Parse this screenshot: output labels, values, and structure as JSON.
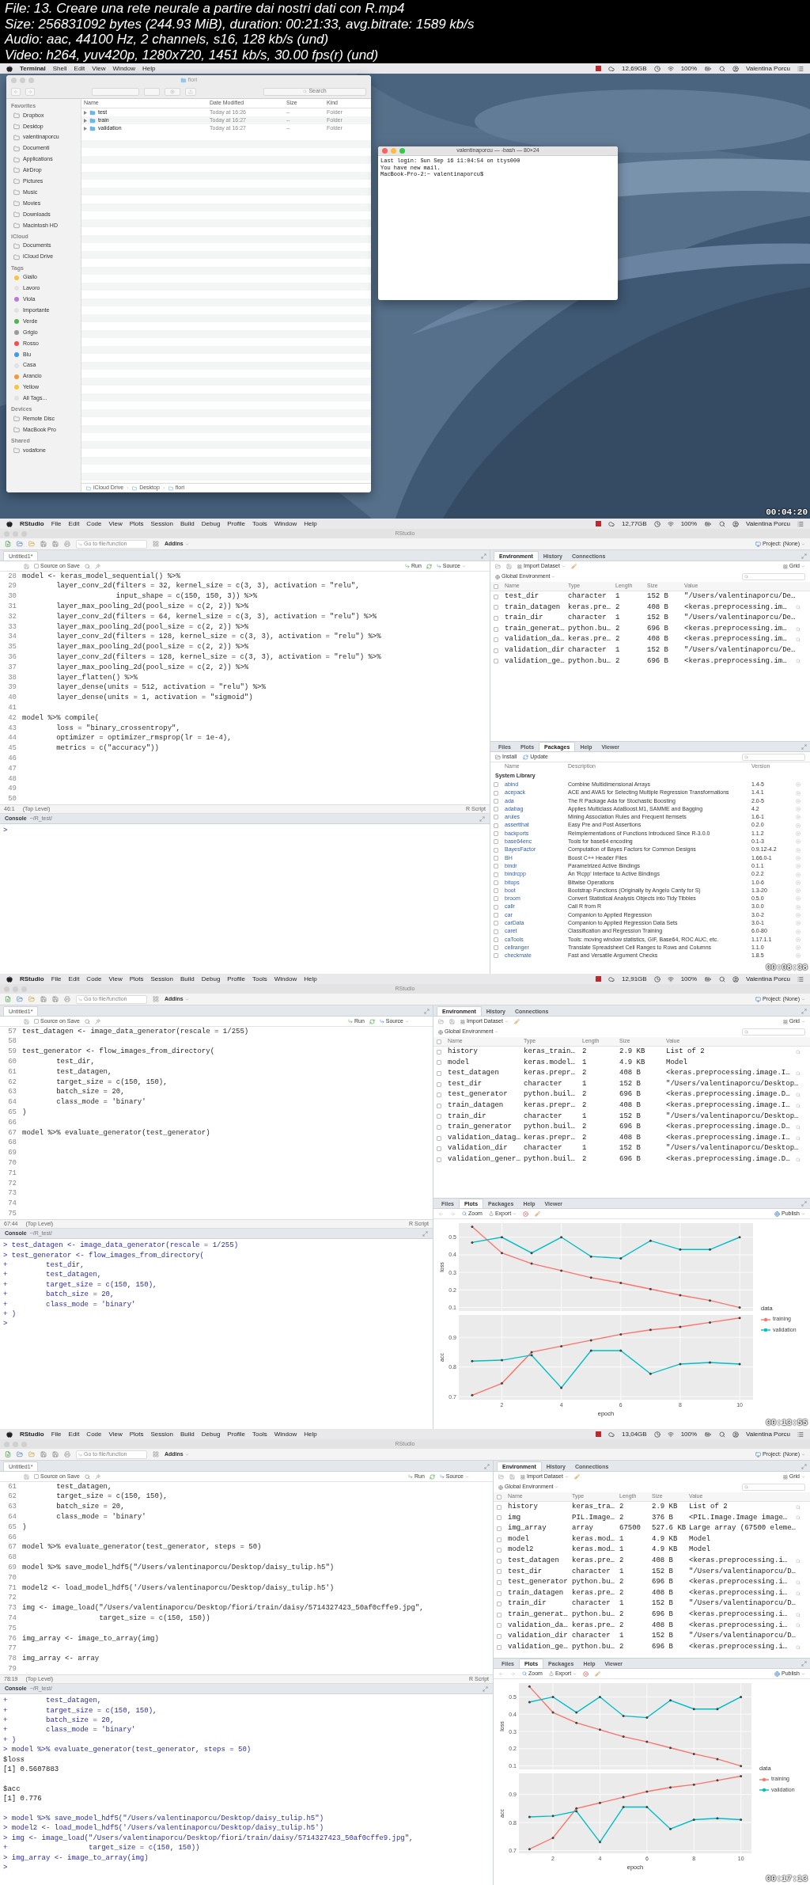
{
  "file_info": [
    "File: 13. Creare una rete neurale a partire dai nostri dati con R.mp4",
    "Size: 256831092 bytes (244.93 MiB), duration: 00:21:33, avg.bitrate: 1589 kb/s",
    "Audio: aac, 44100 Hz, 2 channels, s16, 128 kb/s (und)",
    "Video: h264, yuv420p, 1280x720, 1451 kb/s, 30.00 fps(r) (und)"
  ],
  "frames": [
    {
      "kind": "desktop",
      "menubar": {
        "app": "Terminal",
        "menus": [
          "Shell",
          "Edit",
          "View",
          "Window",
          "Help"
        ],
        "storage": "12,69GB",
        "battery": "100%",
        "user": "Valentina Porcu"
      },
      "finder": {
        "title": "fiori",
        "search": {
          "placeholder": "Search"
        },
        "sections": [
          {
            "title": "Favorites",
            "kind": "places",
            "items": [
              "Dropbox",
              "Desktop",
              "valentinaporcu",
              "Documenti",
              "Applications",
              "AirDrop",
              "Pictures",
              "Music",
              "Movies",
              "Downloads",
              "Macintosh HD"
            ]
          },
          {
            "title": "iCloud",
            "kind": "places",
            "items": [
              "Documents",
              "iCloud Drive"
            ]
          },
          {
            "title": "Tags",
            "kind": "tags",
            "items": [
              {
                "label": "Giallo",
                "color": "#f5c542"
              },
              {
                "label": "Lavoro",
                "color": "#e2e2e2"
              },
              {
                "label": "Viola",
                "color": "#b67ae0"
              },
              {
                "label": "Importante",
                "color": "#e2e2e2"
              },
              {
                "label": "Verde",
                "color": "#4cb84c"
              },
              {
                "label": "Grigio",
                "color": "#9a9a9a"
              },
              {
                "label": "Rosso",
                "color": "#f0504f"
              },
              {
                "label": "Blu",
                "color": "#3d9cf0"
              },
              {
                "label": "Casa",
                "color": "#e2e2e2"
              },
              {
                "label": "Arancio",
                "color": "#f59a32"
              },
              {
                "label": "Yellow",
                "color": "#f5c542"
              },
              {
                "label": "All Tags...",
                "color": "#e2e2e2"
              }
            ]
          },
          {
            "title": "Devices",
            "kind": "places",
            "items": [
              "Remote Disc",
              "MacBook Pro"
            ]
          },
          {
            "title": "Shared",
            "kind": "places",
            "items": [
              "vodafone"
            ]
          }
        ],
        "columns": [
          "Name",
          "Date Modified",
          "Size",
          "Kind"
        ],
        "rows": [
          {
            "name": "test",
            "date": "Today at 16:26",
            "size": "--",
            "file_kind": "Folder"
          },
          {
            "name": "train",
            "date": "Today at 16:27",
            "size": "--",
            "file_kind": "Folder"
          },
          {
            "name": "validation",
            "date": "Today at 16:27",
            "size": "--",
            "file_kind": "Folder"
          }
        ],
        "path": [
          "iCloud Drive",
          "Desktop",
          "fiori"
        ]
      },
      "terminal": {
        "title": "valentinaporcu — -bash — 80×24",
        "lines": [
          "Last login: Sun Sep 16 11:04:54 on ttys000",
          "You have new mail.",
          "MacBook-Pro-2:~ valentinaporcu$"
        ]
      },
      "timestamp": "00:04:20"
    },
    {
      "kind": "rstudio",
      "menubar": {
        "app": "RStudio",
        "menus": [
          "File",
          "Edit",
          "Code",
          "View",
          "Plots",
          "Session",
          "Build",
          "Debug",
          "Profile",
          "Tools",
          "Window",
          "Help"
        ],
        "storage": "12,77GB",
        "battery": "100%",
        "user": "Valentina Porcu"
      },
      "window_title": "RStudio",
      "goto": {
        "placeholder": "Go to file/function"
      },
      "addins": "Addins",
      "project": "Project: (None)",
      "source": {
        "tab": "Untitled1*",
        "source_on_save": {
          "label": "Source on Save",
          "checked": false
        },
        "run": "Run",
        "source_button": "Source",
        "position": "46:1",
        "scope": "(Top Level)",
        "file_type": "R Script",
        "lines": [
          {
            "n": "28",
            "text": "model <- keras_model_sequential() %>%"
          },
          {
            "n": "29",
            "text": "        layer_conv_2d(filters = 32, kernel_size = c(3, 3), activation = \"relu\","
          },
          {
            "n": "30",
            "text": "                      input_shape = c(150, 150, 3)) %>%"
          },
          {
            "n": "31",
            "text": "        layer_max_pooling_2d(pool_size = c(2, 2)) %>%"
          },
          {
            "n": "32",
            "text": "        layer_conv_2d(filters = 64, kernel_size = c(3, 3), activation = \"relu\") %>%"
          },
          {
            "n": "33",
            "text": "        layer_max_pooling_2d(pool_size = c(2, 2)) %>%"
          },
          {
            "n": "34",
            "text": "        layer_conv_2d(filters = 128, kernel_size = c(3, 3), activation = \"relu\") %>%"
          },
          {
            "n": "35",
            "text": "        layer_max_pooling_2d(pool_size = c(2, 2)) %>%"
          },
          {
            "n": "36",
            "text": "        layer_conv_2d(filters = 128, kernel_size = c(3, 3), activation = \"relu\") %>%"
          },
          {
            "n": "37",
            "text": "        layer_max_pooling_2d(pool_size = c(2, 2)) %>%"
          },
          {
            "n": "38",
            "text": "        layer_flatten() %>%"
          },
          {
            "n": "39",
            "text": "        layer_dense(units = 512, activation = \"relu\") %>%"
          },
          {
            "n": "40",
            "text": "        layer_dense(units = 1, activation = \"sigmoid\")"
          },
          {
            "n": "41"
          },
          {
            "n": "42",
            "text": "model %>% compile("
          },
          {
            "n": "43",
            "text": "        loss = \"binary_crossentropy\","
          },
          {
            "n": "44",
            "text": "        optimizer = optimizer_rmsprop(lr = 1e-4),"
          },
          {
            "n": "45",
            "text": "        metrics = c(\"accuracy\"))"
          },
          {
            "n": "46"
          },
          {
            "n": "47"
          },
          {
            "n": "48"
          },
          {
            "n": "49"
          },
          {
            "n": "50"
          }
        ]
      },
      "console": {
        "title": "Console",
        "path": "~/R_test/",
        "lines": [
          {
            "kind": "input",
            "text": ">"
          }
        ]
      },
      "environment": {
        "tabs": [
          {
            "label": "Environment",
            "selected": true
          },
          {
            "label": "History",
            "selected": false
          },
          {
            "label": "Connections",
            "selected": false
          }
        ],
        "import": "Import Dataset",
        "view": "Grid",
        "scope": "Global Environment",
        "all_checked": false,
        "columns": [
          "Name",
          "Type",
          "Length",
          "Size",
          "Value"
        ],
        "rows": [
          {
            "name": "test_dir",
            "type": "character",
            "length": "1",
            "size": "152 B",
            "value": "\"/Users/valentinaporcu/De…",
            "inspect": false,
            "checked": false
          },
          {
            "name": "train_datagen",
            "type": "keras.pre…",
            "length": "2",
            "size": "408 B",
            "value": "<keras.preprocessing.im…",
            "inspect": true,
            "checked": false
          },
          {
            "name": "train_dir",
            "type": "character",
            "length": "1",
            "size": "152 B",
            "value": "\"/Users/valentinaporcu/De…",
            "inspect": false,
            "checked": false
          },
          {
            "name": "train_generat…",
            "type": "python.bu…",
            "length": "2",
            "size": "696 B",
            "value": "<keras.preprocessing.im…",
            "inspect": true,
            "checked": false
          },
          {
            "name": "validation_da…",
            "type": "keras.pre…",
            "length": "2",
            "size": "408 B",
            "value": "<keras.preprocessing.im…",
            "inspect": true,
            "checked": false
          },
          {
            "name": "validation_dir",
            "type": "character",
            "length": "1",
            "size": "152 B",
            "value": "\"/Users/valentinaporcu/De…",
            "inspect": false,
            "checked": false
          },
          {
            "name": "validation_ge…",
            "type": "python.bu…",
            "length": "2",
            "size": "696 B",
            "value": "<keras.preprocessing.im…",
            "inspect": true,
            "checked": false
          }
        ]
      },
      "lower": {
        "kind": "packages",
        "tabs": [
          {
            "label": "Files",
            "selected": false
          },
          {
            "label": "Plots",
            "selected": false
          },
          {
            "label": "Packages",
            "selected": true
          },
          {
            "label": "Help",
            "selected": false
          },
          {
            "label": "Viewer",
            "selected": false
          }
        ],
        "install": "Install",
        "update": "Update",
        "columns": [
          "Name",
          "Description",
          "Version"
        ],
        "library": "System Library",
        "packages": [
          {
            "name": "abind",
            "description": "Combine Multidimensional Arrays",
            "version": "1.4-5",
            "checked": false
          },
          {
            "name": "acepack",
            "description": "ACE and AVAS for Selecting Multiple Regression Transformations",
            "version": "1.4.1",
            "checked": false
          },
          {
            "name": "ada",
            "description": "The R Package Ada for Stochastic Boosting",
            "version": "2.0-5",
            "checked": false
          },
          {
            "name": "adabag",
            "description": "Applies Multiclass AdaBoost.M1, SAMME and Bagging",
            "version": "4.2",
            "checked": false
          },
          {
            "name": "arules",
            "description": "Mining Association Rules and Frequent Itemsets",
            "version": "1.6-1",
            "checked": false
          },
          {
            "name": "assertthat",
            "description": "Easy Pre and Post Assertions",
            "version": "0.2.0",
            "checked": false
          },
          {
            "name": "backports",
            "description": "Reimplementations of Functions Introduced Since R-3.0.0",
            "version": "1.1.2",
            "checked": false
          },
          {
            "name": "base64enc",
            "description": "Tools for base64 encoding",
            "version": "0.1-3",
            "checked": false
          },
          {
            "name": "BayesFactor",
            "description": "Computation of Bayes Factors for Common Designs",
            "version": "0.9.12-4.2",
            "checked": false
          },
          {
            "name": "BH",
            "description": "Boost C++ Header Files",
            "version": "1.66.0-1",
            "checked": false
          },
          {
            "name": "bindr",
            "description": "Parametrized Active Bindings",
            "version": "0.1.1",
            "checked": false
          },
          {
            "name": "bindrcpp",
            "description": "An 'Rcpp' Interface to Active Bindings",
            "version": "0.2.2",
            "checked": false
          },
          {
            "name": "bitops",
            "description": "Bitwise Operations",
            "version": "1.0-6",
            "checked": false
          },
          {
            "name": "boot",
            "description": "Bootstrap Functions (Originally by Angelo Canty for S)",
            "version": "1.3-20",
            "checked": false
          },
          {
            "name": "broom",
            "description": "Convert Statistical Analysis Objects into Tidy Tibbles",
            "version": "0.5.0",
            "checked": false
          },
          {
            "name": "callr",
            "description": "Call R from R",
            "version": "3.0.0",
            "checked": false
          },
          {
            "name": "car",
            "description": "Companion to Applied Regression",
            "version": "3.0-2",
            "checked": false
          },
          {
            "name": "carData",
            "description": "Companion to Applied Regression Data Sets",
            "version": "3.0-1",
            "checked": false
          },
          {
            "name": "caret",
            "description": "Classification and Regression Training",
            "version": "6.0-80",
            "checked": false
          },
          {
            "name": "caTools",
            "description": "Tools: moving window statistics, GIF, Base64, ROC AUC, etc.",
            "version": "1.17.1.1",
            "checked": false
          },
          {
            "name": "cellranger",
            "description": "Translate Spreadsheet Cell Ranges to Rows and Columns",
            "version": "1.1.0",
            "checked": false
          },
          {
            "name": "checkmate",
            "description": "Fast and Versatile Argument Checks",
            "version": "1.8.5",
            "checked": false
          }
        ]
      },
      "timestamp": "00:08:38"
    },
    {
      "kind": "rstudio",
      "menubar": {
        "app": "RStudio",
        "menus": [
          "File",
          "Edit",
          "Code",
          "View",
          "Plots",
          "Session",
          "Build",
          "Debug",
          "Profile",
          "Tools",
          "Window",
          "Help"
        ],
        "storage": "12,91GB",
        "battery": "100%",
        "user": "Valentina Porcu"
      },
      "window_title": "RStudio",
      "goto": {
        "placeholder": "Go to file/function"
      },
      "addins": "Addins",
      "project": "Project: (None)",
      "source": {
        "tab": "Untitled1*",
        "source_on_save": {
          "label": "Source on Save",
          "checked": false
        },
        "run": "Run",
        "source_button": "Source",
        "position": "67:44",
        "scope": "(Top Level)",
        "file_type": "R Script",
        "lines": [
          {
            "n": "57",
            "text": "test_datagen <- image_data_generator(rescale = 1/255)"
          },
          {
            "n": "58"
          },
          {
            "n": "59",
            "text": "test_generator <- flow_images_from_directory("
          },
          {
            "n": "60",
            "text": "        test_dir,"
          },
          {
            "n": "61",
            "text": "        test_datagen,"
          },
          {
            "n": "62",
            "text": "        target_size = c(150, 150),"
          },
          {
            "n": "63",
            "text": "        batch_size = 20,"
          },
          {
            "n": "64",
            "text": "        class_mode = 'binary'"
          },
          {
            "n": "65",
            "text": ")"
          },
          {
            "n": "66"
          },
          {
            "n": "67",
            "text": "model %>% evaluate_generator(test_generator)"
          },
          {
            "n": "68"
          },
          {
            "n": "69"
          },
          {
            "n": "70"
          },
          {
            "n": "71"
          },
          {
            "n": "72"
          },
          {
            "n": "73"
          },
          {
            "n": "74"
          },
          {
            "n": "75"
          }
        ]
      },
      "console": {
        "title": "Console",
        "path": "~/R_test/",
        "lines": [
          {
            "kind": "input",
            "text": "> test_datagen <- image_data_generator(rescale = 1/255)"
          },
          {
            "kind": "input",
            "text": "> test_generator <- flow_images_from_directory("
          },
          {
            "kind": "input",
            "text": "+         test_dir,"
          },
          {
            "kind": "input",
            "text": "+         test_datagen,"
          },
          {
            "kind": "input",
            "text": "+         target_size = c(150, 150),"
          },
          {
            "kind": "input",
            "text": "+         batch_size = 20,"
          },
          {
            "kind": "input",
            "text": "+         class_mode = 'binary'"
          },
          {
            "kind": "input",
            "text": "+ )"
          },
          {
            "kind": "input",
            "text": ">"
          }
        ]
      },
      "environment": {
        "tabs": [
          {
            "label": "Environment",
            "selected": true
          },
          {
            "label": "History",
            "selected": false
          },
          {
            "label": "Connections",
            "selected": false
          }
        ],
        "import": "Import Dataset",
        "view": "Grid",
        "scope": "Global Environment",
        "all_checked": false,
        "columns": [
          "Name",
          "Type",
          "Length",
          "Size",
          "Value"
        ],
        "rows": [
          {
            "name": "history",
            "type": "keras_train…",
            "length": "2",
            "size": "2.9 KB",
            "value": "List of 2",
            "inspect": true,
            "checked": false
          },
          {
            "name": "model",
            "type": "keras.model…",
            "length": "1",
            "size": "4.9 KB",
            "value": "Model",
            "inspect": false,
            "checked": false
          },
          {
            "name": "test_datagen",
            "type": "keras.prepr…",
            "length": "2",
            "size": "408 B",
            "value": "<keras.preprocessing.image.I…",
            "inspect": true,
            "checked": false
          },
          {
            "name": "test_dir",
            "type": "character",
            "length": "1",
            "size": "152 B",
            "value": "\"/Users/valentinaporcu/Desktop…",
            "inspect": false,
            "checked": false
          },
          {
            "name": "test_generator",
            "type": "python.buil…",
            "length": "2",
            "size": "696 B",
            "value": "<keras.preprocessing.image.D…",
            "inspect": true,
            "checked": false
          },
          {
            "name": "train_datagen",
            "type": "keras.prepr…",
            "length": "2",
            "size": "408 B",
            "value": "<keras.preprocessing.image.I…",
            "inspect": true,
            "checked": false
          },
          {
            "name": "train_dir",
            "type": "character",
            "length": "1",
            "size": "152 B",
            "value": "\"/Users/valentinaporcu/Desktop…",
            "inspect": false,
            "checked": false
          },
          {
            "name": "train_generator",
            "type": "python.buil…",
            "length": "2",
            "size": "696 B",
            "value": "<keras.preprocessing.image.D…",
            "inspect": true,
            "checked": false
          },
          {
            "name": "validation_datag…",
            "type": "keras.prepr…",
            "length": "2",
            "size": "408 B",
            "value": "<keras.preprocessing.image.I…",
            "inspect": true,
            "checked": false
          },
          {
            "name": "validation_dir",
            "type": "character",
            "length": "1",
            "size": "152 B",
            "value": "\"/Users/valentinaporcu/Desktop…",
            "inspect": false,
            "checked": false
          },
          {
            "name": "validation_gener…",
            "type": "python.buil…",
            "length": "2",
            "size": "696 B",
            "value": "<keras.preprocessing.image.D…",
            "inspect": true,
            "checked": false
          }
        ]
      },
      "lower": {
        "kind": "plots",
        "tabs": [
          {
            "label": "Files",
            "selected": false
          },
          {
            "label": "Plots",
            "selected": true
          },
          {
            "label": "Packages",
            "selected": false
          },
          {
            "label": "Help",
            "selected": false
          },
          {
            "label": "Viewer",
            "selected": false
          }
        ],
        "zoom": "Zoom",
        "export": "Export",
        "publish": "Publish",
        "plot": {
          "facets": [
            {
              "chart_data": {
                "type": "line",
                "ylabel": "loss",
                "grid": true,
                "x": [
                  1,
                  2,
                  3,
                  4,
                  5,
                  6,
                  7,
                  8,
                  9,
                  10
                ],
                "xlim": [
                  0.55,
                  10.45
                ],
                "ylim": [
                  0.08,
                  0.58
                ],
                "yticks": [
                  0.1,
                  0.2,
                  0.3,
                  0.4,
                  0.5
                ],
                "series": [
                  {
                    "color": "#f8766d",
                    "values": [
                      0.56,
                      0.41,
                      0.35,
                      0.31,
                      0.27,
                      0.24,
                      0.205,
                      0.17,
                      0.14,
                      0.1
                    ]
                  },
                  {
                    "color": "#00bfc4",
                    "values": [
                      0.47,
                      0.5,
                      0.41,
                      0.5,
                      0.39,
                      0.38,
                      0.48,
                      0.43,
                      0.43,
                      0.5
                    ]
                  }
                ]
              }
            },
            {
              "chart_data": {
                "type": "line",
                "xlabel": "epoch",
                "ylabel": "acc",
                "grid": true,
                "x": [
                  1,
                  2,
                  3,
                  4,
                  5,
                  6,
                  7,
                  8,
                  9,
                  10
                ],
                "xlim": [
                  0.55,
                  10.45
                ],
                "ylim": [
                  0.69,
                  0.975
                ],
                "xticks": [
                  2,
                  4,
                  6,
                  8,
                  10
                ],
                "yticks": [
                  0.7,
                  0.8,
                  0.9
                ],
                "series": [
                  {
                    "color": "#f8766d",
                    "values": [
                      0.705,
                      0.745,
                      0.85,
                      0.87,
                      0.89,
                      0.91,
                      0.925,
                      0.935,
                      0.95,
                      0.965
                    ]
                  },
                  {
                    "color": "#00bfc4",
                    "values": [
                      0.82,
                      0.823,
                      0.84,
                      0.73,
                      0.855,
                      0.855,
                      0.777,
                      0.81,
                      0.815,
                      0.81
                    ]
                  }
                ]
              }
            }
          ],
          "legend": {
            "title": "data",
            "items": [
              {
                "label": "training",
                "color": "#f8766d"
              },
              {
                "label": "validation",
                "color": "#00bfc4"
              }
            ]
          }
        }
      },
      "timestamp": "00:13:55"
    },
    {
      "kind": "rstudio",
      "menubar": {
        "app": "RStudio",
        "menus": [
          "File",
          "Edit",
          "Code",
          "View",
          "Plots",
          "Session",
          "Build",
          "Debug",
          "Profile",
          "Tools",
          "Window",
          "Help"
        ],
        "storage": "13,04GB",
        "battery": "100%",
        "user": "Valentina Porcu"
      },
      "window_title": "RStudio",
      "goto": {
        "placeholder": "Go to file/function"
      },
      "addins": "Addins",
      "project": "Project: (None)",
      "source": {
        "tab": "Untitled1*",
        "source_on_save": {
          "label": "Source on Save",
          "checked": false
        },
        "run": "Run",
        "source_button": "Source",
        "position": "78:19",
        "scope": "(Top Level)",
        "file_type": "R Script",
        "lines": [
          {
            "n": "61",
            "text": "        test_datagen,"
          },
          {
            "n": "62",
            "text": "        target_size = c(150, 150),"
          },
          {
            "n": "63",
            "text": "        batch_size = 20,"
          },
          {
            "n": "64",
            "text": "        class_mode = 'binary'"
          },
          {
            "n": "65",
            "text": ")"
          },
          {
            "n": "66"
          },
          {
            "n": "67",
            "text": "model %>% evaluate_generator(test_generator, steps = 50)"
          },
          {
            "n": "68"
          },
          {
            "n": "69",
            "text": "model %>% save_model_hdf5(\"/Users/valentinaporcu/Desktop/daisy_tulip.h5\")"
          },
          {
            "n": "70"
          },
          {
            "n": "71",
            "text": "model2 <- load_model_hdf5('/Users/valentinaporcu/Desktop/daisy_tulip.h5')"
          },
          {
            "n": "72"
          },
          {
            "n": "73",
            "text": "img <- image_load(\"/Users/valentinaporcu/Desktop/fiori/train/daisy/5714327423_50af0cffe9.jpg\","
          },
          {
            "n": "74",
            "text": "                  target_size = c(150, 150))"
          },
          {
            "n": "75"
          },
          {
            "n": "76",
            "text": "img_array <- image_to_array(img)"
          },
          {
            "n": "77"
          },
          {
            "n": "78",
            "text": "img_array <- array"
          },
          {
            "n": "79"
          }
        ]
      },
      "console": {
        "title": "Console",
        "path": "~/R_test/",
        "lines": [
          {
            "kind": "input",
            "text": "+         test_datagen,"
          },
          {
            "kind": "input",
            "text": "+         target_size = c(150, 150),"
          },
          {
            "kind": "input",
            "text": "+         batch_size = 20,"
          },
          {
            "kind": "input",
            "text": "+         class_mode = 'binary'"
          },
          {
            "kind": "input",
            "text": "+ )"
          },
          {
            "kind": "input",
            "text": "> model %>% evaluate_generator(test_generator, steps = 50)"
          },
          {
            "kind": "output",
            "text": "$loss"
          },
          {
            "kind": "output",
            "text": "[1] 0.5607883"
          },
          {
            "kind": "gap"
          },
          {
            "kind": "output",
            "text": "$acc"
          },
          {
            "kind": "output",
            "text": "[1] 0.776"
          },
          {
            "kind": "gap"
          },
          {
            "kind": "input",
            "text": "> model %>% save_model_hdf5(\"/Users/valentinaporcu/Desktop/daisy_tulip.h5\")"
          },
          {
            "kind": "input",
            "text": "> model2 <- load_model_hdf5('/Users/valentinaporcu/Desktop/daisy_tulip.h5')"
          },
          {
            "kind": "input",
            "text": "> img <- image_load(\"/Users/valentinaporcu/Desktop/fiori/train/daisy/5714327423_50af0cffe9.jpg\","
          },
          {
            "kind": "input",
            "text": "+                   target_size = c(150, 150))"
          },
          {
            "kind": "input",
            "text": "> img_array <- image_to_array(img)"
          },
          {
            "kind": "input",
            "text": ">"
          }
        ]
      },
      "environment": {
        "tabs": [
          {
            "label": "Environment",
            "selected": true
          },
          {
            "label": "History",
            "selected": false
          },
          {
            "label": "Connections",
            "selected": false
          }
        ],
        "import": "Import Dataset",
        "view": "Grid",
        "scope": "Global Environment",
        "all_checked": false,
        "columns": [
          "Name",
          "Type",
          "Length",
          "Size",
          "Value"
        ],
        "rows": [
          {
            "name": "history",
            "type": "keras_tra…",
            "length": "2",
            "size": "2.9 KB",
            "value": "List of 2",
            "inspect": true,
            "checked": false
          },
          {
            "name": "img",
            "type": "PIL.Image…",
            "length": "2",
            "size": "376 B",
            "value": "<PIL.Image.Image image…",
            "inspect": true,
            "checked": false
          },
          {
            "name": "img_array",
            "type": "array",
            "length": "67500",
            "size": "527.6 KB",
            "value": "Large array (67500 eleme…",
            "inspect": false,
            "checked": false
          },
          {
            "name": "model",
            "type": "keras.mod…",
            "length": "1",
            "size": "4.9 KB",
            "value": "Model",
            "inspect": false,
            "checked": false
          },
          {
            "name": "model2",
            "type": "keras.mod…",
            "length": "1",
            "size": "4.9 KB",
            "value": "Model",
            "inspect": false,
            "checked": false
          },
          {
            "name": "test_datagen",
            "type": "keras.pre…",
            "length": "2",
            "size": "408 B",
            "value": "<keras.preprocessing.i…",
            "inspect": true,
            "checked": false
          },
          {
            "name": "test_dir",
            "type": "character",
            "length": "1",
            "size": "152 B",
            "value": "\"/Users/valentinaporcu/D…",
            "inspect": false,
            "checked": false
          },
          {
            "name": "test_generator",
            "type": "python.bu…",
            "length": "2",
            "size": "696 B",
            "value": "<keras.preprocessing.i…",
            "inspect": true,
            "checked": false
          },
          {
            "name": "train_datagen",
            "type": "keras.pre…",
            "length": "2",
            "size": "408 B",
            "value": "<keras.preprocessing.i…",
            "inspect": true,
            "checked": false
          },
          {
            "name": "train_dir",
            "type": "character",
            "length": "1",
            "size": "152 B",
            "value": "\"/Users/valentinaporcu/D…",
            "inspect": false,
            "checked": false
          },
          {
            "name": "train_generat…",
            "type": "python.bu…",
            "length": "2",
            "size": "696 B",
            "value": "<keras.preprocessing.i…",
            "inspect": true,
            "checked": false
          },
          {
            "name": "validation_da…",
            "type": "keras.pre…",
            "length": "2",
            "size": "408 B",
            "value": "<keras.preprocessing.i…",
            "inspect": true,
            "checked": false
          },
          {
            "name": "validation_dir",
            "type": "character",
            "length": "1",
            "size": "152 B",
            "value": "\"/Users/valentinaporcu/D…",
            "inspect": false,
            "checked": false
          },
          {
            "name": "validation_ge…",
            "type": "python.bu…",
            "length": "2",
            "size": "696 B",
            "value": "<keras.preprocessing.i…",
            "inspect": true,
            "checked": false
          }
        ]
      },
      "lower": {
        "kind": "plots",
        "tabs": [
          {
            "label": "Files",
            "selected": false
          },
          {
            "label": "Plots",
            "selected": true
          },
          {
            "label": "Packages",
            "selected": false
          },
          {
            "label": "Help",
            "selected": false
          },
          {
            "label": "Viewer",
            "selected": false
          }
        ],
        "zoom": "Zoom",
        "export": "Export",
        "publish": "Publish",
        "plot": {
          "facets": [
            {
              "chart_data": {
                "type": "line",
                "ylabel": "loss",
                "grid": true,
                "x": [
                  1,
                  2,
                  3,
                  4,
                  5,
                  6,
                  7,
                  8,
                  9,
                  10
                ],
                "xlim": [
                  0.55,
                  10.45
                ],
                "ylim": [
                  0.08,
                  0.58
                ],
                "yticks": [
                  0.1,
                  0.2,
                  0.3,
                  0.4,
                  0.5
                ],
                "series": [
                  {
                    "color": "#f8766d",
                    "values": [
                      0.56,
                      0.41,
                      0.35,
                      0.31,
                      0.27,
                      0.24,
                      0.205,
                      0.17,
                      0.14,
                      0.1
                    ]
                  },
                  {
                    "color": "#00bfc4",
                    "values": [
                      0.47,
                      0.5,
                      0.41,
                      0.5,
                      0.39,
                      0.38,
                      0.48,
                      0.43,
                      0.43,
                      0.5
                    ]
                  }
                ]
              }
            },
            {
              "chart_data": {
                "type": "line",
                "xlabel": "epoch",
                "ylabel": "acc",
                "grid": true,
                "x": [
                  1,
                  2,
                  3,
                  4,
                  5,
                  6,
                  7,
                  8,
                  9,
                  10
                ],
                "xlim": [
                  0.55,
                  10.45
                ],
                "ylim": [
                  0.69,
                  0.975
                ],
                "xticks": [
                  2,
                  4,
                  6,
                  8,
                  10
                ],
                "yticks": [
                  0.7,
                  0.8,
                  0.9
                ],
                "series": [
                  {
                    "color": "#f8766d",
                    "values": [
                      0.705,
                      0.745,
                      0.85,
                      0.87,
                      0.89,
                      0.91,
                      0.925,
                      0.935,
                      0.95,
                      0.965
                    ]
                  },
                  {
                    "color": "#00bfc4",
                    "values": [
                      0.82,
                      0.823,
                      0.84,
                      0.73,
                      0.855,
                      0.855,
                      0.777,
                      0.81,
                      0.815,
                      0.81
                    ]
                  }
                ]
              }
            }
          ],
          "legend": {
            "title": "data",
            "items": [
              {
                "label": "training",
                "color": "#f8766d"
              },
              {
                "label": "validation",
                "color": "#00bfc4"
              }
            ]
          }
        }
      },
      "timestamp": "00:17:13"
    }
  ]
}
